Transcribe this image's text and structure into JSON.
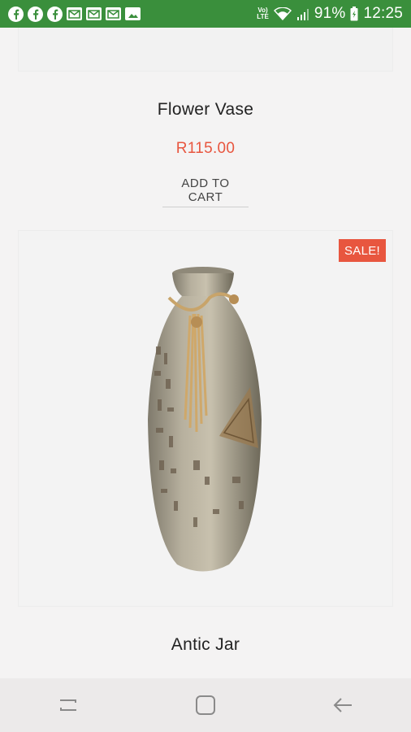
{
  "status_bar": {
    "battery_percent": "91%",
    "time": "12:25",
    "network_label": "Vo)\nLTE",
    "notification_icons": [
      "facebook-icon",
      "facebook-icon",
      "facebook-icon",
      "gmail-icon",
      "gmail-icon",
      "gmail-icon",
      "image-icon"
    ]
  },
  "products": [
    {
      "title": "Flower Vase",
      "price": "R115.00",
      "cta": "ADD TO CART"
    },
    {
      "title": "Antic Jar",
      "badge": "SALE!"
    }
  ],
  "colors": {
    "status_bar": "#3a8f3c",
    "price": "#e8563f",
    "sale_badge": "#e8563f",
    "background": "#f4f3f3"
  },
  "nav_bar": {
    "buttons": [
      "recents-icon",
      "home-icon",
      "back-icon"
    ]
  }
}
